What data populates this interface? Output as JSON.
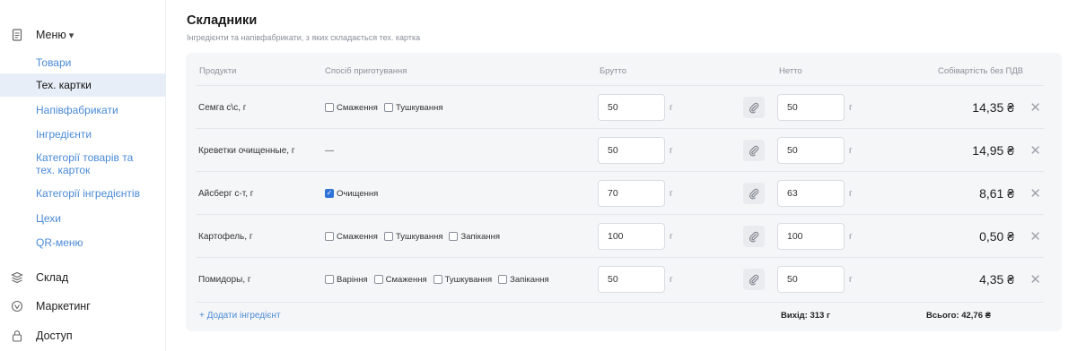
{
  "sidebar": {
    "menu": {
      "label": "Меню",
      "caret": "▾",
      "icon": "document-icon"
    },
    "items": [
      {
        "label": "Товари",
        "active": false
      },
      {
        "label": "Тех. картки",
        "active": true
      },
      {
        "label": "Напівфабрикати",
        "active": false
      },
      {
        "label": "Інгредієнти",
        "active": false
      },
      {
        "label": "Категорії товарів та\nтех. карток",
        "active": false
      },
      {
        "label": "Категорії інгредієнтів",
        "active": false
      },
      {
        "label": "Цехи",
        "active": false
      },
      {
        "label": "QR-меню",
        "active": false
      }
    ],
    "warehouse": {
      "label": "Склад",
      "icon": "layers-icon"
    },
    "marketing": {
      "label": "Маркетинг",
      "icon": "marketing-icon"
    },
    "access": {
      "label": "Доступ",
      "icon": "lock-icon"
    }
  },
  "section": {
    "title": "Складники",
    "subtitle": "Інгредієнти та напівфабрикати, з яких складається тех. картка"
  },
  "table": {
    "headers": {
      "products": "Продукти",
      "method": "Спосіб приготування",
      "gross": "Брутто",
      "net": "Нетто",
      "cost": "Собівартість без ПДВ"
    },
    "unit": "г",
    "rows": [
      {
        "product": "Семга с\\с, г",
        "methods": [
          {
            "label": "Смаження",
            "checked": false
          },
          {
            "label": "Тушкування",
            "checked": false
          }
        ],
        "gross": "50",
        "net": "50",
        "cost": "14,35 ₴"
      },
      {
        "product": "Креветки очищенные, г",
        "methods": [],
        "no_method": "—",
        "gross": "50",
        "net": "50",
        "cost": "14,95 ₴"
      },
      {
        "product": "Айсберг с-т, г",
        "methods": [
          {
            "label": "Очищення",
            "checked": true
          }
        ],
        "gross": "70",
        "net": "63",
        "cost": "8,61 ₴"
      },
      {
        "product": "Картофель, г",
        "methods": [
          {
            "label": "Смаження",
            "checked": false
          },
          {
            "label": "Тушкування",
            "checked": false
          },
          {
            "label": "Запікання",
            "checked": false
          }
        ],
        "gross": "100",
        "net": "100",
        "cost": "0,50 ₴"
      },
      {
        "product": "Помидоры, г",
        "methods": [
          {
            "label": "Варіння",
            "checked": false
          },
          {
            "label": "Смаження",
            "checked": false
          },
          {
            "label": "Тушкування",
            "checked": false
          },
          {
            "label": "Запікання",
            "checked": false
          }
        ],
        "gross": "50",
        "net": "50",
        "cost": "4,35 ₴"
      }
    ],
    "footer": {
      "add_label": "+ Додати інгредієнт",
      "output": "Вихід: 313 г",
      "total": "Всього: 42,76 ₴"
    }
  },
  "colors": {
    "accent": "#4a8ad6",
    "active_bg": "#e8eef7",
    "checkbox": "#2f73d6",
    "panel": "#f5f6f8"
  }
}
